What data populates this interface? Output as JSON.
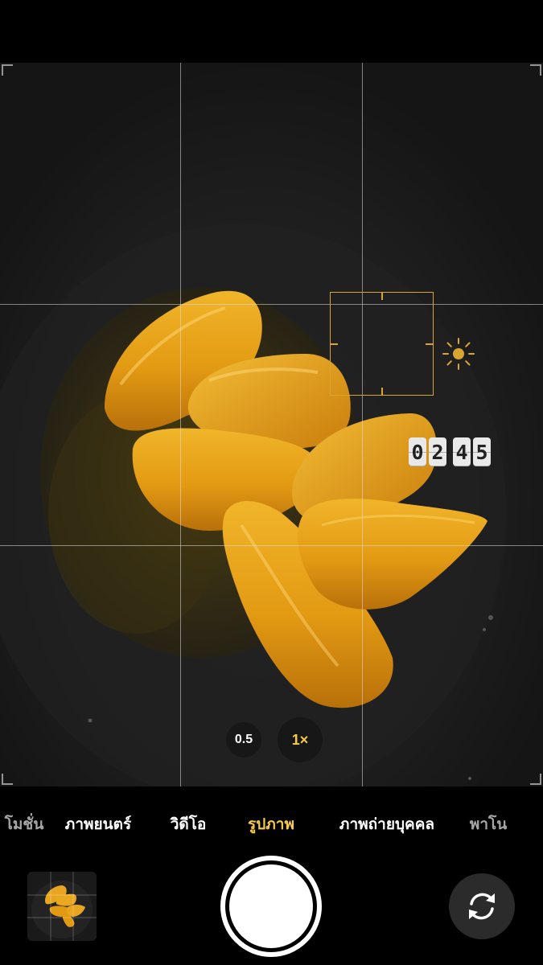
{
  "timer_digits": [
    "0",
    "2",
    "4",
    "5"
  ],
  "zoom": {
    "options": [
      "0.5",
      "1×"
    ],
    "selected": "1×"
  },
  "modes": {
    "items": [
      {
        "label": "โมชั่น",
        "state": "fade"
      },
      {
        "label": "ภาพยนตร์",
        "state": "normal"
      },
      {
        "label": "วิดีโอ",
        "state": "normal"
      },
      {
        "label": "รูปภาพ",
        "state": "active"
      },
      {
        "label": "ภาพถ่ายบุคคล",
        "state": "normal"
      },
      {
        "label": "พาโน",
        "state": "fade"
      }
    ],
    "selected": "รูปภาพ"
  },
  "icons": {
    "exposure": "sun-icon",
    "flip": "flip-camera-icon",
    "shutter": "shutter-button"
  },
  "colors": {
    "accent": "#f7c948",
    "focus_box": "#d9a531",
    "background": "#000000"
  }
}
